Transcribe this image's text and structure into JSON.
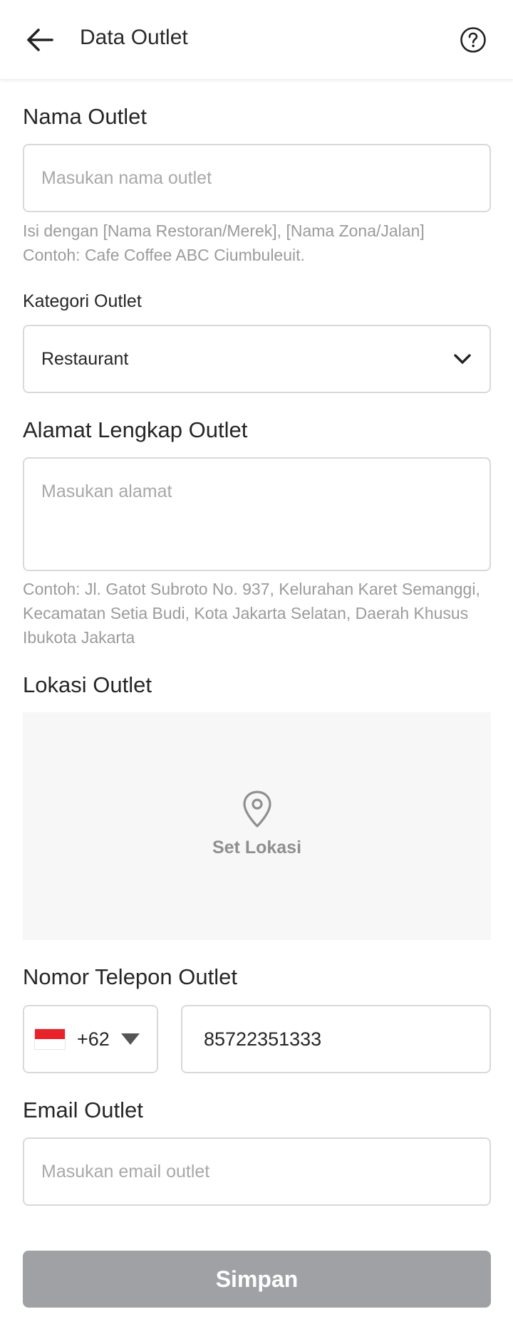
{
  "header": {
    "title": "Data Outlet",
    "back_icon": "arrow-left-icon",
    "help_icon": "help-circle-icon"
  },
  "form": {
    "nama_outlet": {
      "label": "Nama Outlet",
      "placeholder": "Masukan nama outlet",
      "value": "",
      "hint_line1": "Isi dengan [Nama Restoran/Merek], [Nama Zona/Jalan]",
      "hint_line2": "Contoh: Cafe Coffee ABC Ciumbuleuit."
    },
    "kategori_outlet": {
      "label": "Kategori Outlet",
      "selected": "Restaurant"
    },
    "alamat": {
      "label": "Alamat Lengkap Outlet",
      "placeholder": "Masukan alamat",
      "value": "",
      "hint": "Contoh: Jl. Gatot Subroto No. 937, Kelurahan Karet Semanggi, Kecamatan Setia Budi, Kota Jakarta Selatan, Daerah Khusus Ibukota Jakarta"
    },
    "lokasi": {
      "label": "Lokasi Outlet",
      "button_label": "Set Lokasi",
      "icon": "map-pin-icon"
    },
    "telepon": {
      "label": "Nomor Telepon Outlet",
      "country_code": "+62",
      "value": "85722351333"
    },
    "email": {
      "label": "Email Outlet",
      "placeholder": "Masukan email outlet",
      "value": ""
    }
  },
  "submit_label": "Simpan",
  "colors": {
    "submit_disabled": "#a0a1a5",
    "flag_red": "#e8222b",
    "border": "#d9d9d9",
    "hint": "#9b9b9b"
  }
}
